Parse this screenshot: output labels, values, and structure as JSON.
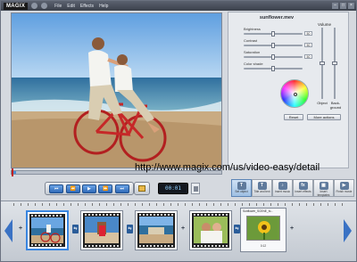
{
  "app": {
    "logo": "MAGIX",
    "menu": [
      "File",
      "Edit",
      "Effects",
      "Help"
    ]
  },
  "panel": {
    "clip_name": "sunflower.mev",
    "volume_label": "Volume",
    "controls": [
      {
        "label": "Brightness",
        "value": "50",
        "level": 0.5
      },
      {
        "label": "Contrast",
        "value": "50",
        "level": 0.5
      },
      {
        "label": "Saturation",
        "value": "50",
        "level": 0.5
      },
      {
        "label": "Color shade",
        "value": "",
        "level": 0.5
      }
    ],
    "object_label": "Object",
    "background_label": "Back-ground",
    "reset_label": "Reset",
    "more_actions_label": "More actions"
  },
  "watermark_url": "http://www.magix.com/us/video-easy/detail",
  "transport": {
    "timecode": "00:01",
    "buttons": [
      "to-start",
      "rewind",
      "play",
      "forward",
      "to-end"
    ]
  },
  "tools": [
    {
      "label": "Set object",
      "icon": "T"
    },
    {
      "label": "Title and text",
      "icon": "T"
    },
    {
      "label": "Insert music",
      "icon": "♪"
    },
    {
      "label": "Insert effects",
      "icon": "fx"
    },
    {
      "label": "Insert templates",
      "icon": "▦"
    },
    {
      "label": "Finish movie",
      "icon": "▶"
    }
  ],
  "storyboard": {
    "clip5_name": "Sunflower_SCENE_fo...",
    "clip5_duration": "0:12"
  },
  "colors": {
    "accent": "#3a86e0",
    "timecode": "#8fd0ff"
  }
}
